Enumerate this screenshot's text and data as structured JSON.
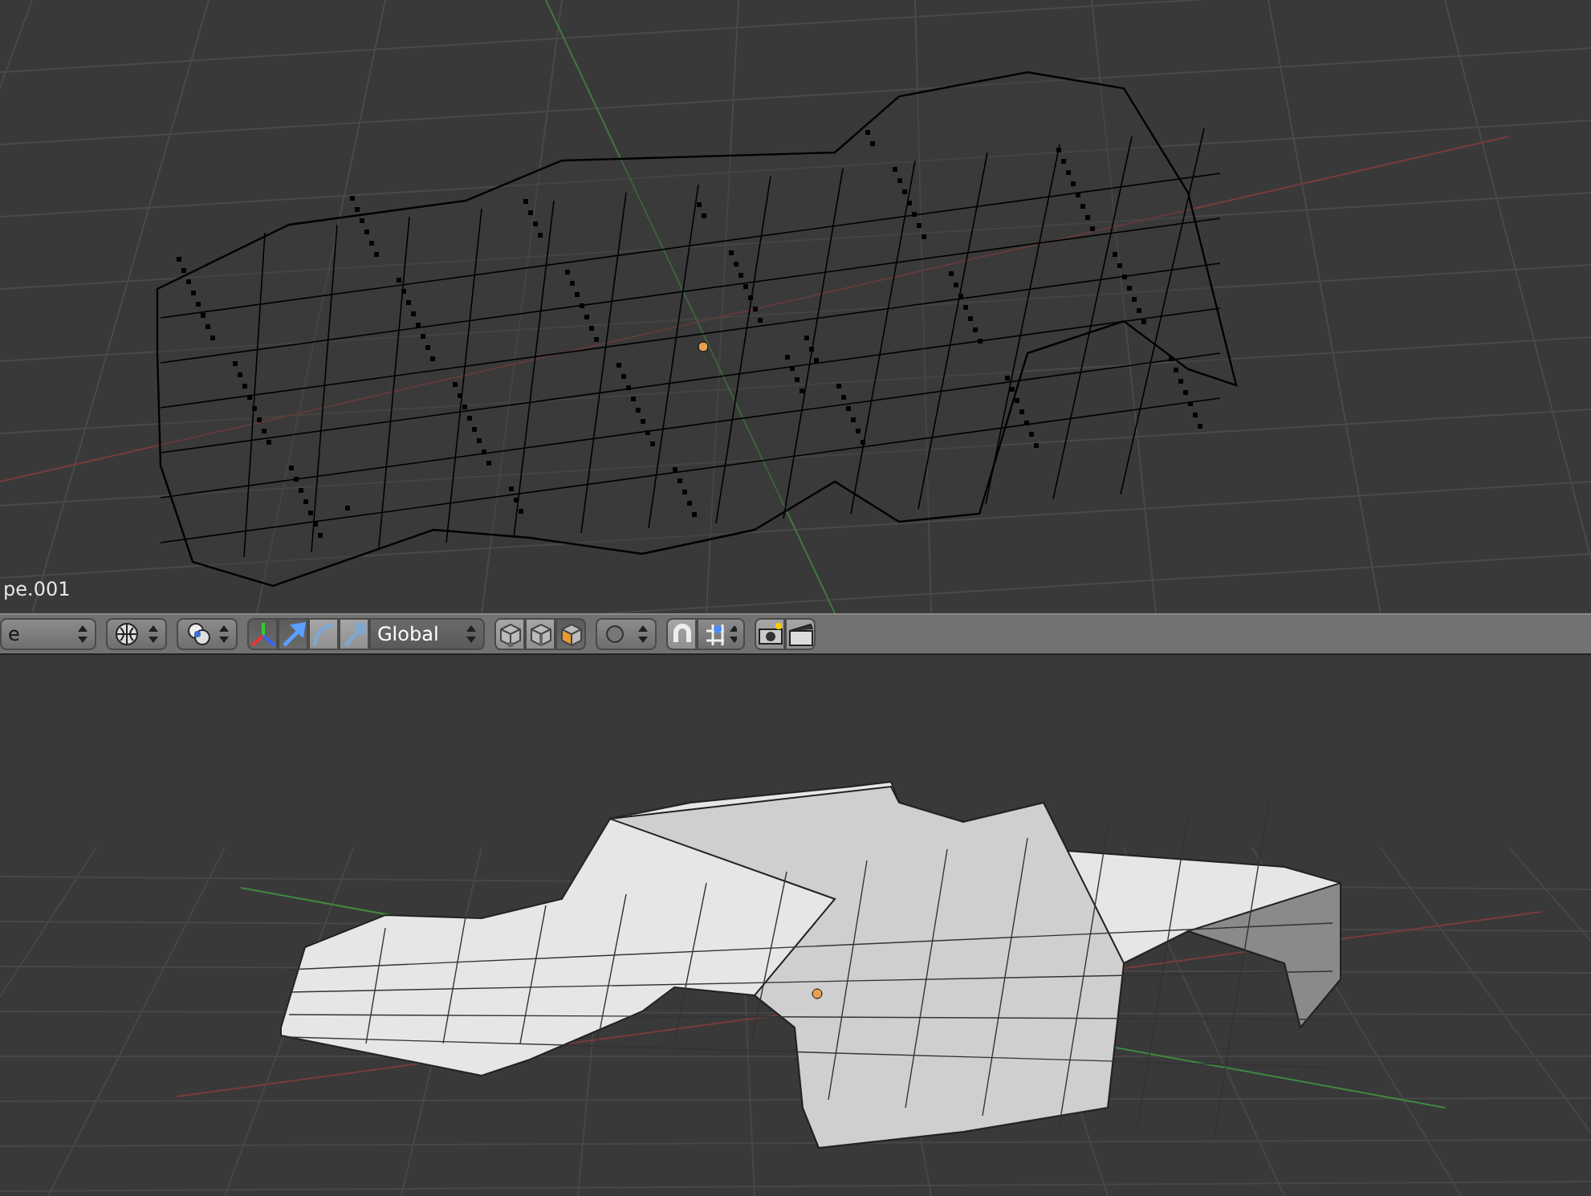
{
  "top_viewport": {
    "object_label": "pe.001"
  },
  "header": {
    "mode_select": {
      "label": "e"
    },
    "manipulators": [
      {
        "kind": "axes",
        "selected": true
      },
      {
        "kind": "translate",
        "selected": true
      },
      {
        "kind": "rotate",
        "selected": false
      },
      {
        "kind": "scale",
        "selected": false
      }
    ],
    "orientation": {
      "label": "Global"
    },
    "select_modes": [
      {
        "kind": "vertex",
        "selected": false
      },
      {
        "kind": "edge",
        "selected": false
      },
      {
        "kind": "face",
        "selected": true
      }
    ],
    "snap": {
      "selected": false
    }
  }
}
